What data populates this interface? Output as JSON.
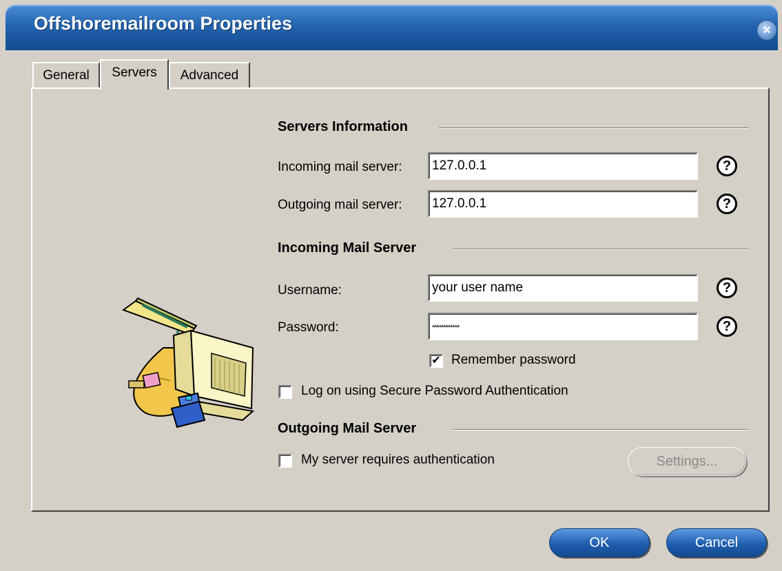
{
  "window": {
    "title": "Offshoremailroom Properties"
  },
  "tabs": [
    {
      "label": "General",
      "active": false
    },
    {
      "label": "Servers",
      "active": true
    },
    {
      "label": "Advanced",
      "active": false
    }
  ],
  "servers_info": {
    "title": "Servers Information",
    "incoming_label": "Incoming mail server:",
    "incoming_value": "127.0.0.1",
    "outgoing_label": "Outgoing mail server:",
    "outgoing_value": "127.0.0.1"
  },
  "incoming_server": {
    "title": "Incoming Mail Server",
    "username_label": "Username:",
    "username_value": "your user name",
    "password_label": "Password:",
    "password_value": "************",
    "remember_label": "Remember password",
    "remember_checked": true,
    "spa_label": "Log on using Secure Password Authentication",
    "spa_checked": false
  },
  "outgoing_server": {
    "title": "Outgoing Mail Server",
    "auth_label": "My server requires authentication",
    "auth_checked": false,
    "settings_label": "Settings..."
  },
  "help_symbol": "?",
  "close_symbol": "×",
  "check_symbol": "✔",
  "buttons": {
    "ok": "OK",
    "cancel": "Cancel"
  },
  "colors": {
    "title_bar": "#2464b0",
    "button_blue": "#1f5eaf",
    "dialog_bg": "#d4d0c8"
  },
  "icons": {
    "illustration": "mailbox-computer-illustration",
    "help": "help-question-icon",
    "close": "close-icon"
  }
}
